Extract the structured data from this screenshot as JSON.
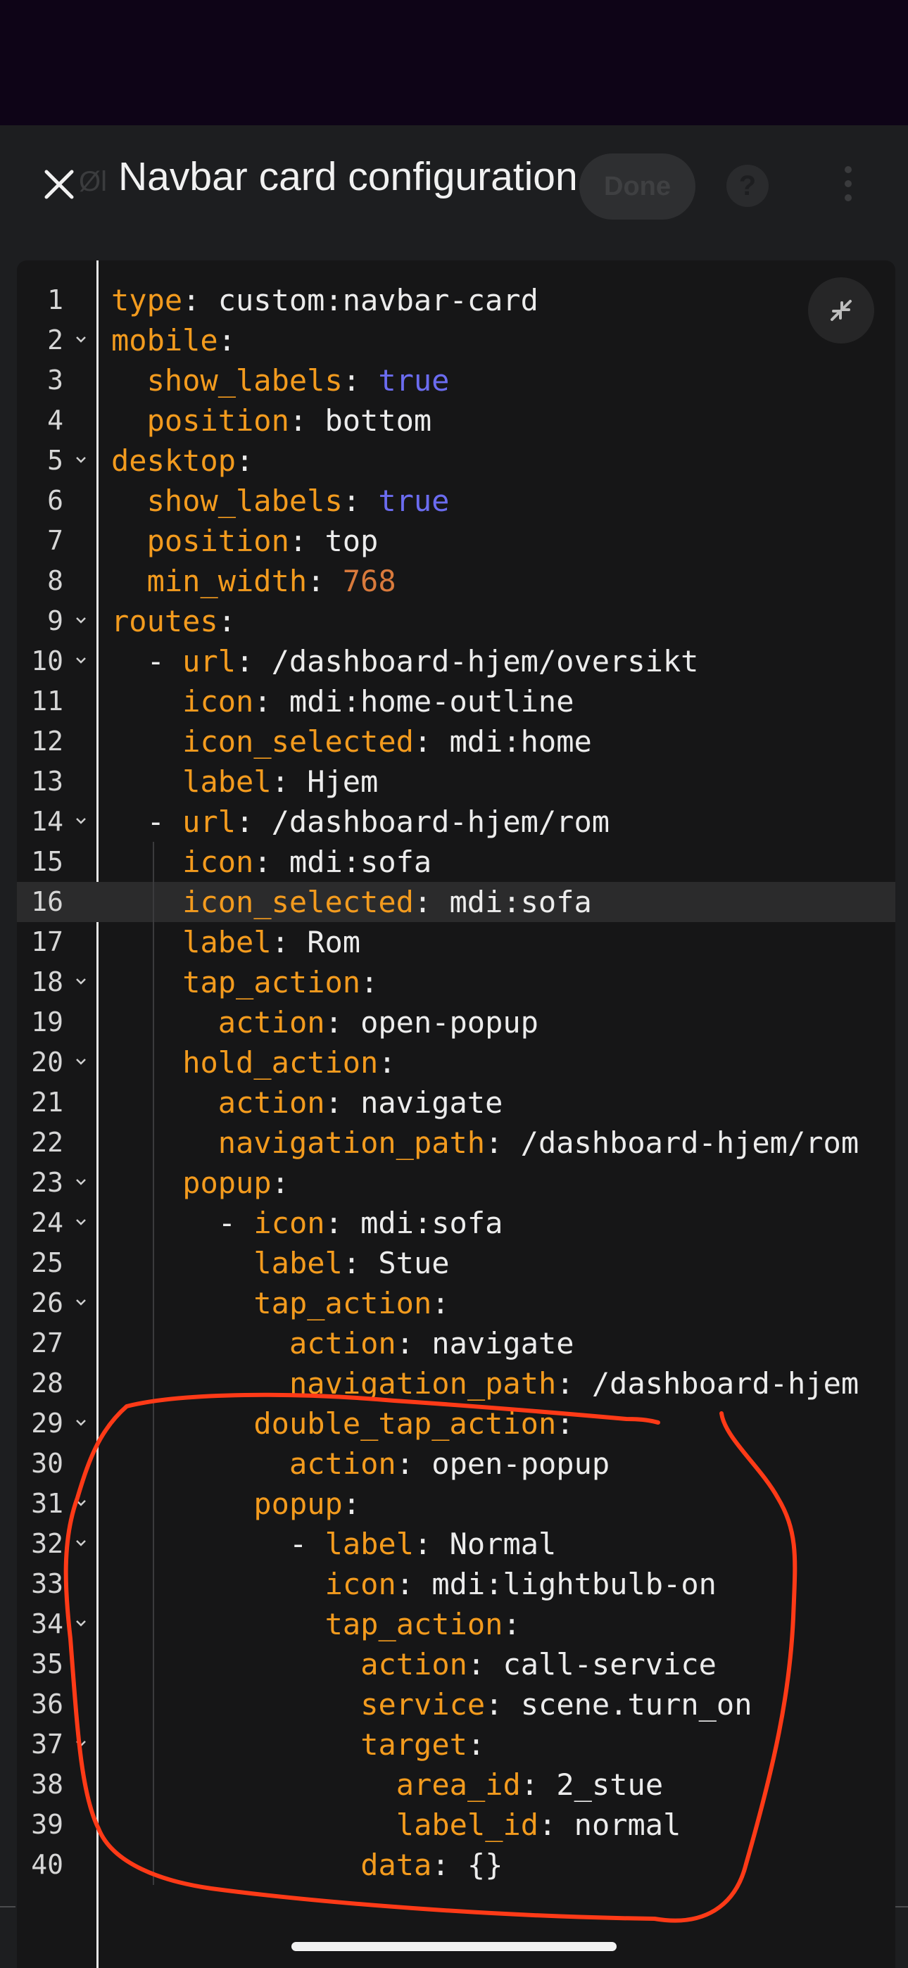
{
  "background_toolbar": {
    "text": "Øl",
    "done_label": "Done",
    "help_glyph": "?"
  },
  "dialog": {
    "title": "Navbar card configuration",
    "close_icon": "close-icon"
  },
  "editor": {
    "language": "yaml",
    "active_line": 16,
    "lines": [
      {
        "n": "1",
        "fold": false,
        "indent": 0,
        "seg": [
          [
            "k",
            "type"
          ],
          [
            "p",
            ": custom:navbar-card"
          ]
        ]
      },
      {
        "n": "2",
        "fold": true,
        "indent": 0,
        "seg": [
          [
            "k",
            "mobile"
          ],
          [
            "p",
            ":"
          ]
        ]
      },
      {
        "n": "3",
        "fold": false,
        "indent": 2,
        "seg": [
          [
            "k",
            "show_labels"
          ],
          [
            "p",
            ": "
          ],
          [
            "b",
            "true"
          ]
        ]
      },
      {
        "n": "4",
        "fold": false,
        "indent": 2,
        "seg": [
          [
            "k",
            "position"
          ],
          [
            "p",
            ": bottom"
          ]
        ]
      },
      {
        "n": "5",
        "fold": true,
        "indent": 0,
        "seg": [
          [
            "k",
            "desktop"
          ],
          [
            "p",
            ":"
          ]
        ]
      },
      {
        "n": "6",
        "fold": false,
        "indent": 2,
        "seg": [
          [
            "k",
            "show_labels"
          ],
          [
            "p",
            ": "
          ],
          [
            "b",
            "true"
          ]
        ]
      },
      {
        "n": "7",
        "fold": false,
        "indent": 2,
        "seg": [
          [
            "k",
            "position"
          ],
          [
            "p",
            ": top"
          ]
        ]
      },
      {
        "n": "8",
        "fold": false,
        "indent": 2,
        "seg": [
          [
            "k",
            "min_width"
          ],
          [
            "p",
            ": "
          ],
          [
            "n",
            "768"
          ]
        ]
      },
      {
        "n": "9",
        "fold": true,
        "indent": 0,
        "seg": [
          [
            "k",
            "routes"
          ],
          [
            "p",
            ":"
          ]
        ]
      },
      {
        "n": "10",
        "fold": true,
        "indent": 2,
        "seg": [
          [
            "p",
            "- "
          ],
          [
            "k",
            "url"
          ],
          [
            "p",
            ": /dashboard-hjem/oversikt"
          ]
        ]
      },
      {
        "n": "11",
        "fold": false,
        "indent": 4,
        "seg": [
          [
            "k",
            "icon"
          ],
          [
            "p",
            ": mdi:home-outline"
          ]
        ]
      },
      {
        "n": "12",
        "fold": false,
        "indent": 4,
        "seg": [
          [
            "k",
            "icon_selected"
          ],
          [
            "p",
            ": mdi:home"
          ]
        ]
      },
      {
        "n": "13",
        "fold": false,
        "indent": 4,
        "seg": [
          [
            "k",
            "label"
          ],
          [
            "p",
            ": Hjem"
          ]
        ]
      },
      {
        "n": "14",
        "fold": true,
        "indent": 2,
        "seg": [
          [
            "p",
            "- "
          ],
          [
            "k",
            "url"
          ],
          [
            "p",
            ": /dashboard-hjem/rom"
          ]
        ]
      },
      {
        "n": "15",
        "fold": false,
        "indent": 4,
        "seg": [
          [
            "k",
            "icon"
          ],
          [
            "p",
            ": mdi:sofa"
          ]
        ]
      },
      {
        "n": "16",
        "fold": false,
        "indent": 4,
        "seg": [
          [
            "k",
            "icon_selected"
          ],
          [
            "p",
            ": mdi:sofa"
          ]
        ]
      },
      {
        "n": "17",
        "fold": false,
        "indent": 4,
        "seg": [
          [
            "k",
            "label"
          ],
          [
            "p",
            ": Rom"
          ]
        ]
      },
      {
        "n": "18",
        "fold": true,
        "indent": 4,
        "seg": [
          [
            "k",
            "tap_action"
          ],
          [
            "p",
            ":"
          ]
        ]
      },
      {
        "n": "19",
        "fold": false,
        "indent": 6,
        "seg": [
          [
            "k",
            "action"
          ],
          [
            "p",
            ": open-popup"
          ]
        ]
      },
      {
        "n": "20",
        "fold": true,
        "indent": 4,
        "seg": [
          [
            "k",
            "hold_action"
          ],
          [
            "p",
            ":"
          ]
        ]
      },
      {
        "n": "21",
        "fold": false,
        "indent": 6,
        "seg": [
          [
            "k",
            "action"
          ],
          [
            "p",
            ": navigate"
          ]
        ]
      },
      {
        "n": "22",
        "fold": false,
        "indent": 6,
        "seg": [
          [
            "k",
            "navigation_path"
          ],
          [
            "p",
            ": /dashboard-hjem/rom"
          ]
        ]
      },
      {
        "n": "23",
        "fold": true,
        "indent": 4,
        "seg": [
          [
            "k",
            "popup"
          ],
          [
            "p",
            ":"
          ]
        ]
      },
      {
        "n": "24",
        "fold": true,
        "indent": 6,
        "seg": [
          [
            "p",
            "- "
          ],
          [
            "k",
            "icon"
          ],
          [
            "p",
            ": mdi:sofa"
          ]
        ]
      },
      {
        "n": "25",
        "fold": false,
        "indent": 8,
        "seg": [
          [
            "k",
            "label"
          ],
          [
            "p",
            ": Stue"
          ]
        ]
      },
      {
        "n": "26",
        "fold": true,
        "indent": 8,
        "seg": [
          [
            "k",
            "tap_action"
          ],
          [
            "p",
            ":"
          ]
        ]
      },
      {
        "n": "27",
        "fold": false,
        "indent": 10,
        "seg": [
          [
            "k",
            "action"
          ],
          [
            "p",
            ": navigate"
          ]
        ]
      },
      {
        "n": "28",
        "fold": false,
        "indent": 10,
        "seg": [
          [
            "k",
            "navigation_path"
          ],
          [
            "p",
            ": /dashboard-hjem"
          ]
        ]
      },
      {
        "n": "29",
        "fold": true,
        "indent": 8,
        "seg": [
          [
            "k",
            "double_tap_action"
          ],
          [
            "p",
            ":"
          ]
        ]
      },
      {
        "n": "30",
        "fold": false,
        "indent": 10,
        "seg": [
          [
            "k",
            "action"
          ],
          [
            "p",
            ": open-popup"
          ]
        ]
      },
      {
        "n": "31",
        "fold": true,
        "indent": 8,
        "seg": [
          [
            "k",
            "popup"
          ],
          [
            "p",
            ":"
          ]
        ]
      },
      {
        "n": "32",
        "fold": true,
        "indent": 10,
        "seg": [
          [
            "p",
            "- "
          ],
          [
            "k",
            "label"
          ],
          [
            "p",
            ": Normal"
          ]
        ]
      },
      {
        "n": "33",
        "fold": false,
        "indent": 12,
        "seg": [
          [
            "k",
            "icon"
          ],
          [
            "p",
            ": mdi:lightbulb-on"
          ]
        ]
      },
      {
        "n": "34",
        "fold": true,
        "indent": 12,
        "seg": [
          [
            "k",
            "tap_action"
          ],
          [
            "p",
            ":"
          ]
        ]
      },
      {
        "n": "35",
        "fold": false,
        "indent": 14,
        "seg": [
          [
            "k",
            "action"
          ],
          [
            "p",
            ": call-service"
          ]
        ]
      },
      {
        "n": "36",
        "fold": false,
        "indent": 14,
        "seg": [
          [
            "k",
            "service"
          ],
          [
            "p",
            ": scene.turn_on"
          ]
        ]
      },
      {
        "n": "37",
        "fold": true,
        "indent": 14,
        "seg": [
          [
            "k",
            "target"
          ],
          [
            "p",
            ":"
          ]
        ]
      },
      {
        "n": "38",
        "fold": false,
        "indent": 16,
        "seg": [
          [
            "k",
            "area_id"
          ],
          [
            "p",
            ": 2_stue"
          ]
        ]
      },
      {
        "n": "39",
        "fold": false,
        "indent": 16,
        "seg": [
          [
            "k",
            "label_id"
          ],
          [
            "p",
            ": normal"
          ]
        ]
      },
      {
        "n": "40",
        "fold": false,
        "indent": 14,
        "seg": [
          [
            "k",
            "data"
          ],
          [
            "p",
            ": {}"
          ]
        ]
      }
    ]
  },
  "colors": {
    "key": "#f39b1e",
    "boolean": "#6b6cf0",
    "number": "#d97a3c",
    "annotation": "#ff3a17"
  },
  "icons": {
    "expand": "collapse-arrows-icon",
    "fold": "chevron-down-icon"
  }
}
